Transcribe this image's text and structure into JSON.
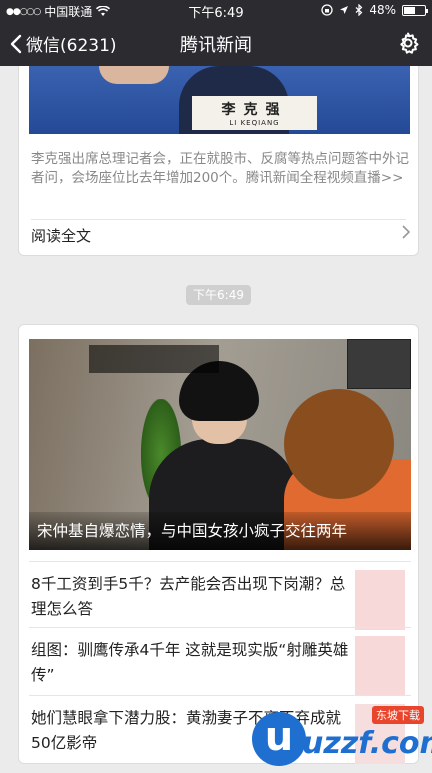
{
  "status_bar": {
    "signal": "●●○○○",
    "carrier": "中国联通",
    "time": "下午6:49",
    "battery": "48%"
  },
  "nav": {
    "back_label": "微信(6231)",
    "title": "腾讯新闻",
    "icons": {
      "back": "chevron-left-icon",
      "settings": "gear-icon"
    }
  },
  "card1": {
    "image_nameplate_cn": "李克强",
    "image_nameplate_en": "LI KEQIANG",
    "summary": "李克强出席总理记者会，正在就股市、反腐等热点问题答中外记者问，会场座位比去年增加200个。腾讯新闻全程视频直播>>",
    "read_more": "阅读全文"
  },
  "time_badge": "下午6:49",
  "card2": {
    "hero_caption": "宋仲基自爆恋情，与中国女孩小疯子交往两年",
    "items": [
      {
        "title": "8千工资到手5千？去产能会否出现下岗潮？总理怎么答"
      },
      {
        "title": "组图：驯鹰传承4千年 这就是现实版“射雕英雄传”"
      },
      {
        "title": "她们慧眼拿下潜力股：黄渤妻子不离不弃成就50亿影帝"
      }
    ]
  },
  "watermark": {
    "mark": "u",
    "text": "uzzf.com",
    "tag": "东坡下载"
  },
  "colors": {
    "nav_bg": "#2b2b30",
    "page_bg": "#ebebeb",
    "summary_text": "#888888",
    "watermark_blue": "#1f6fd0"
  }
}
